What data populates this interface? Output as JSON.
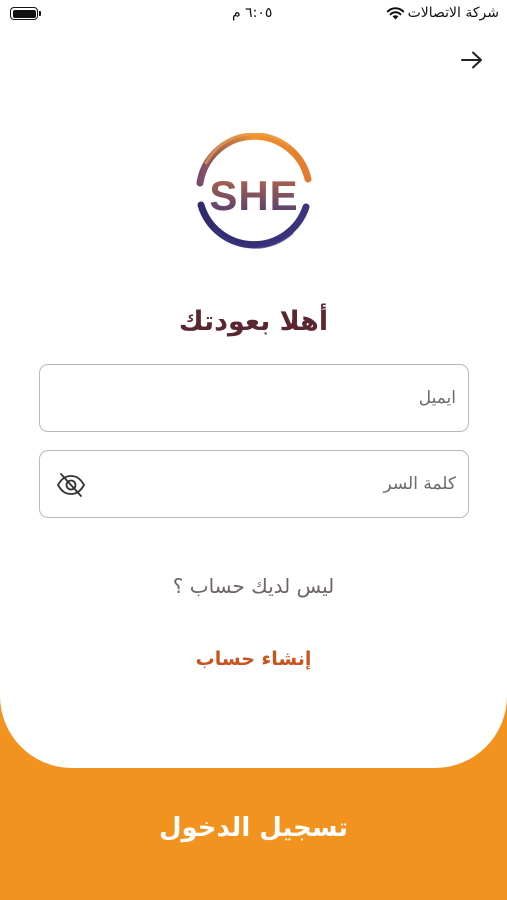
{
  "status_bar": {
    "carrier": "شركة الاتصالات",
    "time": "٦:٠٥ م"
  },
  "icons": {
    "back": "arrow-right-icon",
    "password_toggle": "eye-slash-icon",
    "wifi": "wifi-icon",
    "battery": "battery-icon"
  },
  "logo": {
    "text": "SHE",
    "colors": {
      "top_ring": "#F0942B",
      "bottom_ring": "#2F2A6E",
      "text_top": "#B86A48",
      "text_bottom": "#4A3A72"
    }
  },
  "title": "أهلا بعودتك",
  "form": {
    "email_placeholder": "ايميل",
    "password_placeholder": "كلمة السر"
  },
  "no_account_text": "ليس لديك حساب ؟",
  "create_account_label": "إنشاء حساب",
  "login_button_label": "تسجيل الدخول",
  "colors": {
    "accent": "#F3931F",
    "title": "#5A2630",
    "link": "#C8531D",
    "card": "#FFFFFF"
  }
}
